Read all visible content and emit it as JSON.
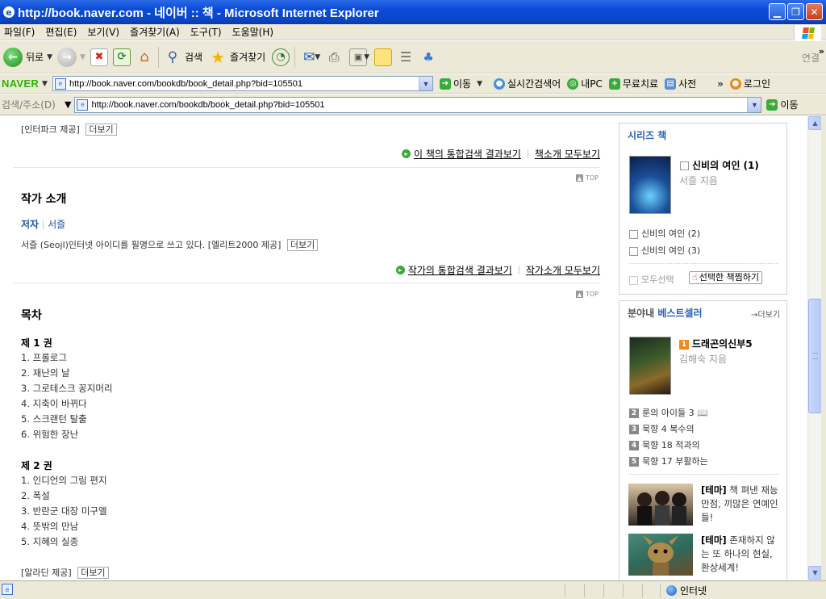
{
  "window": {
    "title": "http://book.naver.com - 네이버 :: 책 - Microsoft Internet Explorer"
  },
  "menu": [
    "파일(F)",
    "편집(E)",
    "보기(V)",
    "즐겨찾기(A)",
    "도구(T)",
    "도움말(H)"
  ],
  "toolbar": {
    "back_label": "뒤로",
    "search_label": "검색",
    "favorites_label": "즐겨찾기",
    "links_label": "연결"
  },
  "naver_bar": {
    "logo": "NAVER",
    "url": "http://book.naver.com/bookdb/book_detail.php?bid=105501",
    "go_label": "이동",
    "items": [
      "실시간검색어",
      "내PC",
      "무료치료",
      "사전"
    ],
    "login_label": "로그인"
  },
  "address_bar": {
    "label": "검색/주소(D)",
    "url": "http://book.naver.com/bookdb/book_detail.php?bid=105501",
    "go_label": "이동"
  },
  "main": {
    "provider_top": "[인터파크 제공]",
    "more_label": "더보기",
    "book_search_link": "이 책의 통합검색 결과보기",
    "book_intro_all_link": "책소개 모두보기",
    "top_label": "TOP",
    "author_section_title": "작가 소개",
    "author_role": "저자",
    "author_name": "서즐",
    "author_desc": "서즐 (Seojl)인터넷 아이디를 필명으로 쓰고 있다. [엘리트2000 제공]",
    "author_search_link": "작가의 통합검색 결과보기",
    "author_intro_all_link": "작가소개 모두보기",
    "toc_title": "목차",
    "volumes": [
      {
        "title": "제 1 권",
        "items": [
          "1. 프롤로그",
          "2. 재난의 날",
          "3. 그로테스크 꽁지머리",
          "4. 지축이 바뀌다",
          "5. 스크랜턴 탈출",
          "6. 위험한 장난"
        ]
      },
      {
        "title": "제 2 권",
        "items": [
          "1. 인디언의 그림 편지",
          "2. 폭설",
          "3. 반란군 대장 미구엘",
          "4. 뜻밖의 만남",
          "5. 지혜의 실종"
        ]
      }
    ],
    "provider_bottom": "[알라딘 제공]"
  },
  "sidebar": {
    "series": {
      "title": "시리즈 책",
      "main_book": "신비의 여인 (1)",
      "main_author": "서즐 지음",
      "items": [
        "신비의 여인 (2)",
        "신비의 여인 (3)"
      ],
      "select_all": "모두선택",
      "bookmark_button": "선택한 책찜하기"
    },
    "bestseller": {
      "title_prefix": "분야내",
      "title_highlight": "베스트셀러",
      "more": "더보기",
      "top_book": "드래곤의신부5",
      "top_author": "김해숙 지음",
      "top_rank": "1",
      "items": [
        {
          "rank": "2",
          "title": "룬의 아이들 3"
        },
        {
          "rank": "3",
          "title": "묵향 4 복수의"
        },
        {
          "rank": "4",
          "title": "묵향 18 적과의"
        },
        {
          "rank": "5",
          "title": "묵향 17 부활하는"
        }
      ]
    },
    "themes": [
      {
        "tag": "[테마]",
        "text": "책 펴낸 재능만점, 끼많은 연예인들!"
      },
      {
        "tag": "[테마]",
        "text": "존재하지 않는 또 하나의 현실, 환상세계!"
      }
    ]
  },
  "status": {
    "zone": "인터넷"
  }
}
